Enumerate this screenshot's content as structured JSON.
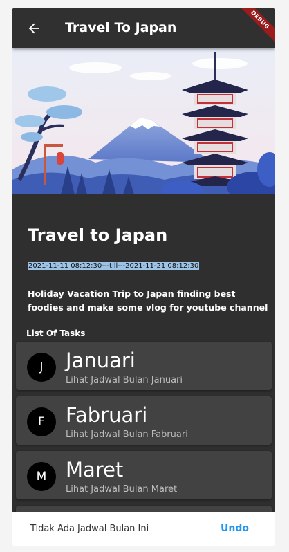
{
  "appbar": {
    "title": "Travel To Japan",
    "back_icon": "arrow-back-icon",
    "debug_banner": "DEBUG"
  },
  "trip": {
    "title": "Travel to Japan",
    "date_range": "2021-11-11 08:12:30---till---2021-11-21 08:12:30",
    "description": "Holiday Vacation Trip to Japan finding best foodies and make some vlog for youtube channel"
  },
  "list_label": "List Of Tasks",
  "tasks": [
    {
      "initial": "J",
      "title": "Januari",
      "subtitle": "Lihat Jadwal Bulan Januari"
    },
    {
      "initial": "F",
      "title": "Fabruari",
      "subtitle": "Lihat Jadwal Bulan Fabruari"
    },
    {
      "initial": "M",
      "title": "Maret",
      "subtitle": "Lihat Jadwal Bulan Maret"
    }
  ],
  "snackbar": {
    "message": "Tidak Ada Jadwal Bulan Ini",
    "action": "Undo"
  },
  "colors": {
    "background": "#2f2f2f",
    "card": "#424242",
    "accent": "#2196f3",
    "date_highlight": "#9cc3e6"
  }
}
